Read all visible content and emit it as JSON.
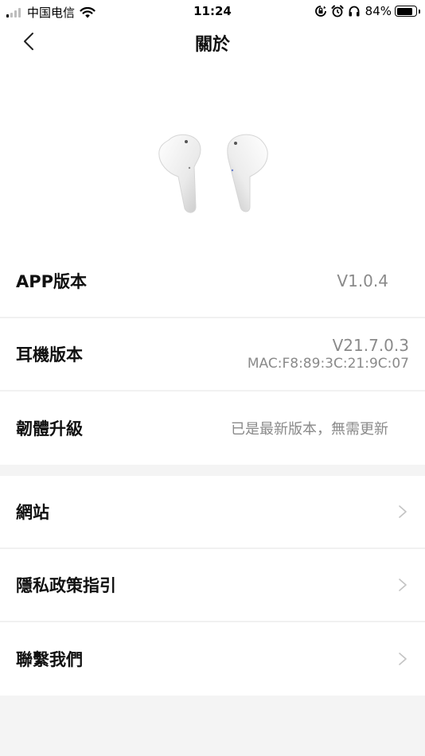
{
  "status_bar": {
    "carrier": "中国电信",
    "time": "11:24",
    "battery_percent": "84%",
    "battery_level": 0.84,
    "icons": [
      "signal-icon",
      "wifi-icon",
      "screen-lock-icon",
      "alarm-icon",
      "headphones-icon",
      "battery-icon"
    ]
  },
  "header": {
    "title": "關於",
    "back_icon": "chevron-left-icon"
  },
  "hero": {
    "image": "earbuds-image"
  },
  "info_rows": [
    {
      "label": "APP版本",
      "value": "V1.0.4"
    },
    {
      "label": "耳機版本",
      "value": "V21.7.0.3",
      "sub_value": "MAC:F8:89:3C:21:9C:07"
    },
    {
      "label": "韌體升級",
      "value": "已是最新版本，無需更新"
    }
  ],
  "link_rows": [
    {
      "label": "網站",
      "icon": "chevron-right-icon"
    },
    {
      "label": "隱私政策指引",
      "icon": "chevron-right-icon"
    },
    {
      "label": "聯繫我們",
      "icon": "chevron-right-icon"
    }
  ],
  "colors": {
    "background": "#f4f4f4",
    "card": "#ffffff",
    "text_primary": "#111111",
    "text_secondary": "#8a8a8a"
  }
}
